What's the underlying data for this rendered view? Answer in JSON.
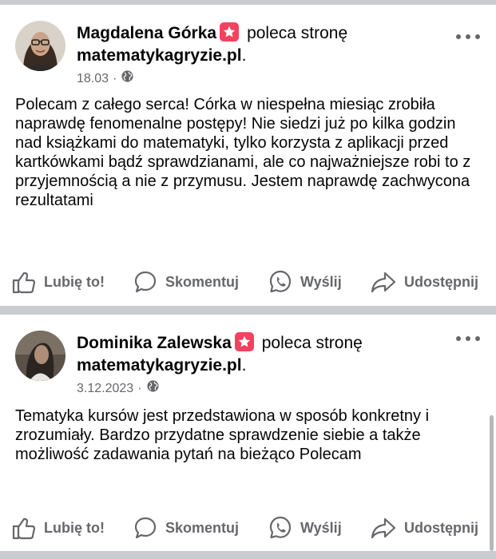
{
  "posts": [
    {
      "author": "Magdalena Górka",
      "action": "poleca stronę",
      "page": "matematykagryzie.pl",
      "page_suffix": ".",
      "date": "18.03",
      "separator": "·",
      "audience_icon": "globe-icon",
      "text": "Polecam z całego serca! Córka w niespełna miesiąc zrobiła naprawdę fenomenalne postępy! Nie siedzi już po kilka godzin nad książkami do matematyki, tylko korzysta z aplikacji przed kartkówkami bądź sprawdzianami, ale co najważniejsze robi to z przyjemnością a nie z przymusu. Jestem naprawdę zachwycona rezultatami",
      "actions": {
        "like": "Lubię to!",
        "comment": "Skomentuj",
        "send": "Wyślij",
        "share": "Udostępnij"
      }
    },
    {
      "author": "Dominika Zalewska",
      "action": "poleca stronę",
      "page": "matematykagryzie.pl",
      "page_suffix": ".",
      "date": "3.12.2023",
      "separator": "·",
      "audience_icon": "globe-icon",
      "text": "Tematyka kursów jest przedstawiona w sposób konkretny i zrozumiały. Bardzo przydatne sprawdzenie siebie a także możliwość zadawania pytań na bieżąco Polecam",
      "actions": {
        "like": "Lubię to!",
        "comment": "Skomentuj",
        "send": "Wyślij",
        "share": "Udostępnij"
      }
    }
  ],
  "colors": {
    "recommend_badge": "#f3425f",
    "secondary_text": "#65676b",
    "divider": "#c9ccd1"
  }
}
